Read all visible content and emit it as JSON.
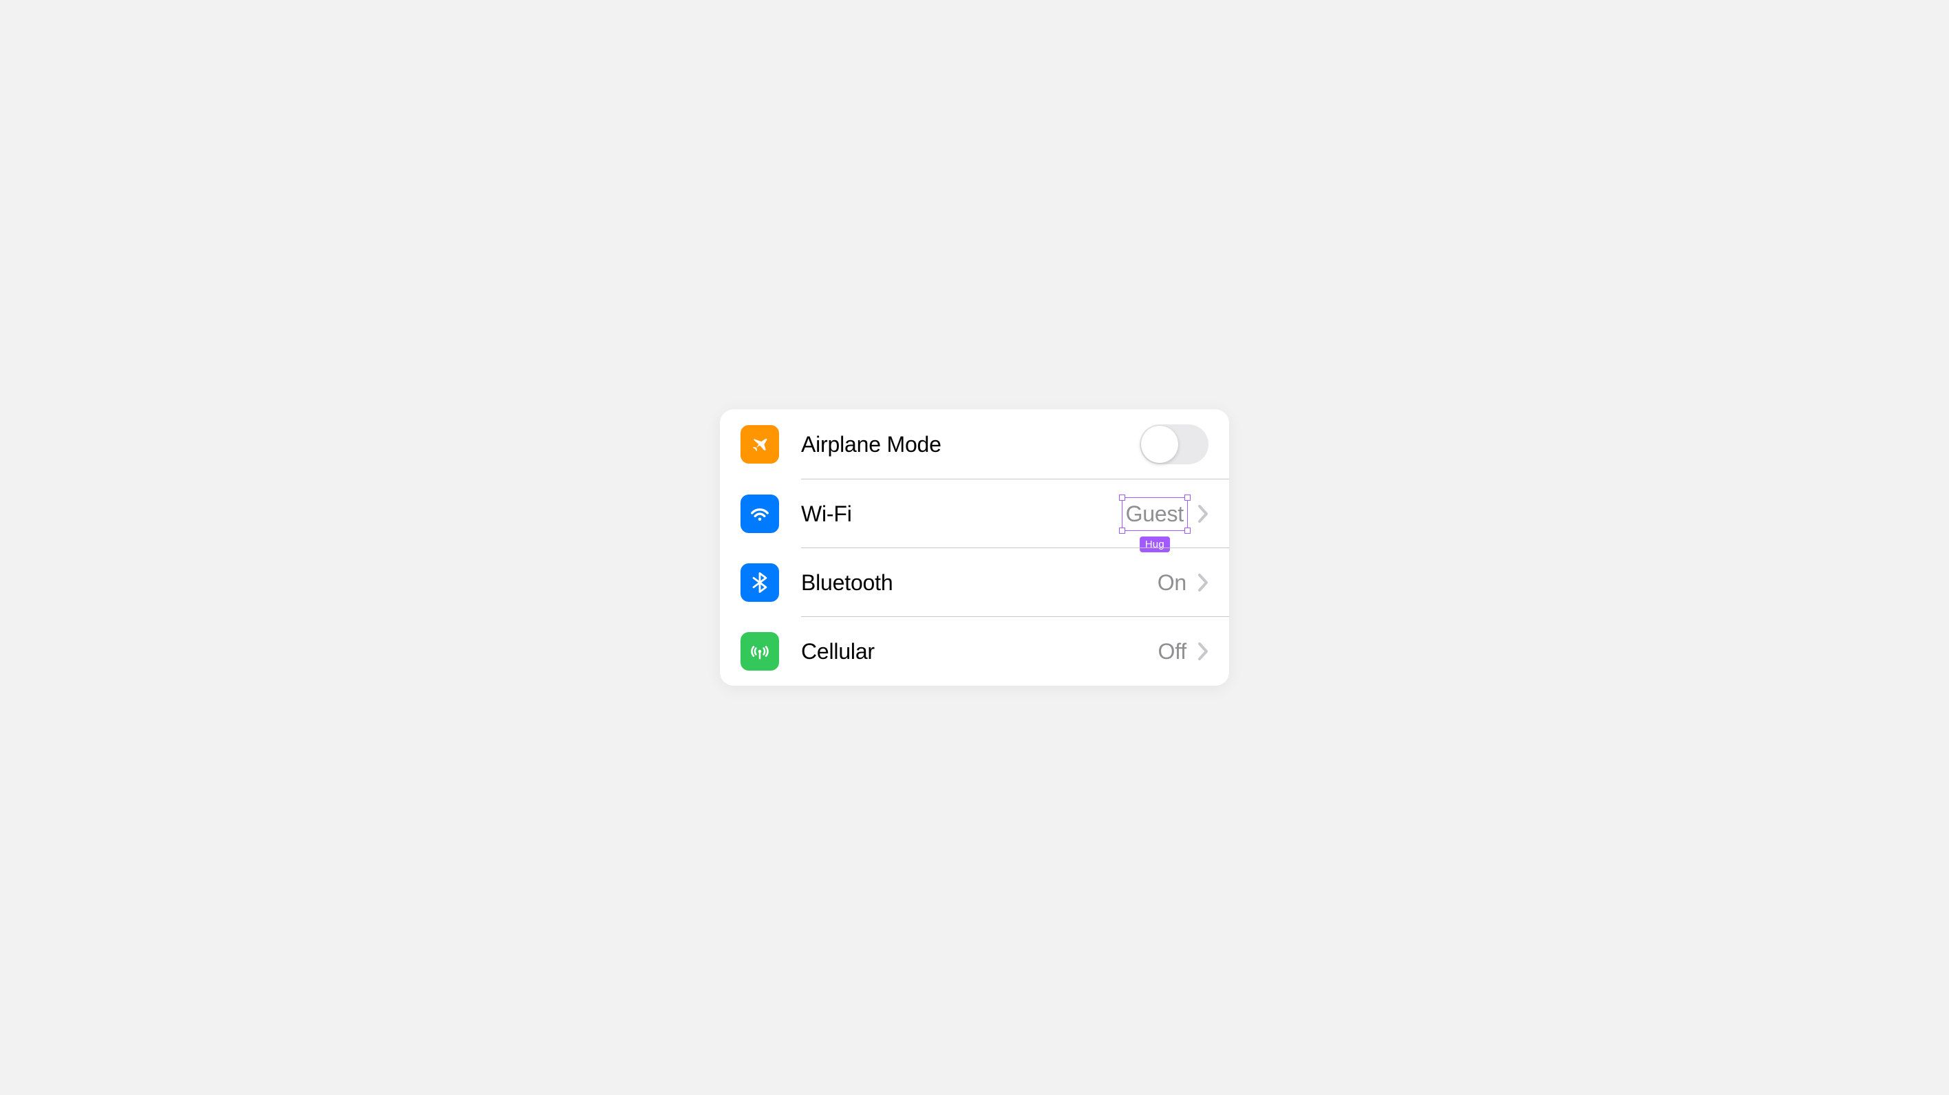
{
  "colors": {
    "airplane_icon_bg": "#ff9500",
    "wifi_icon_bg": "#007aff",
    "bluetooth_icon_bg": "#007aff",
    "cellular_icon_bg": "#34c759",
    "value_text": "#8e8e93",
    "selection_accent": "#a259ff"
  },
  "rows": {
    "airplane": {
      "label": "Airplane Mode",
      "icon": "airplane-icon",
      "toggle_on": false
    },
    "wifi": {
      "label": "Wi-Fi",
      "icon": "wifi-icon",
      "value": "Guest"
    },
    "bluetooth": {
      "label": "Bluetooth",
      "icon": "bluetooth-icon",
      "value": "On"
    },
    "cellular": {
      "label": "Cellular",
      "icon": "cellular-icon",
      "value": "Off"
    }
  },
  "selection": {
    "badge": "Hug"
  }
}
